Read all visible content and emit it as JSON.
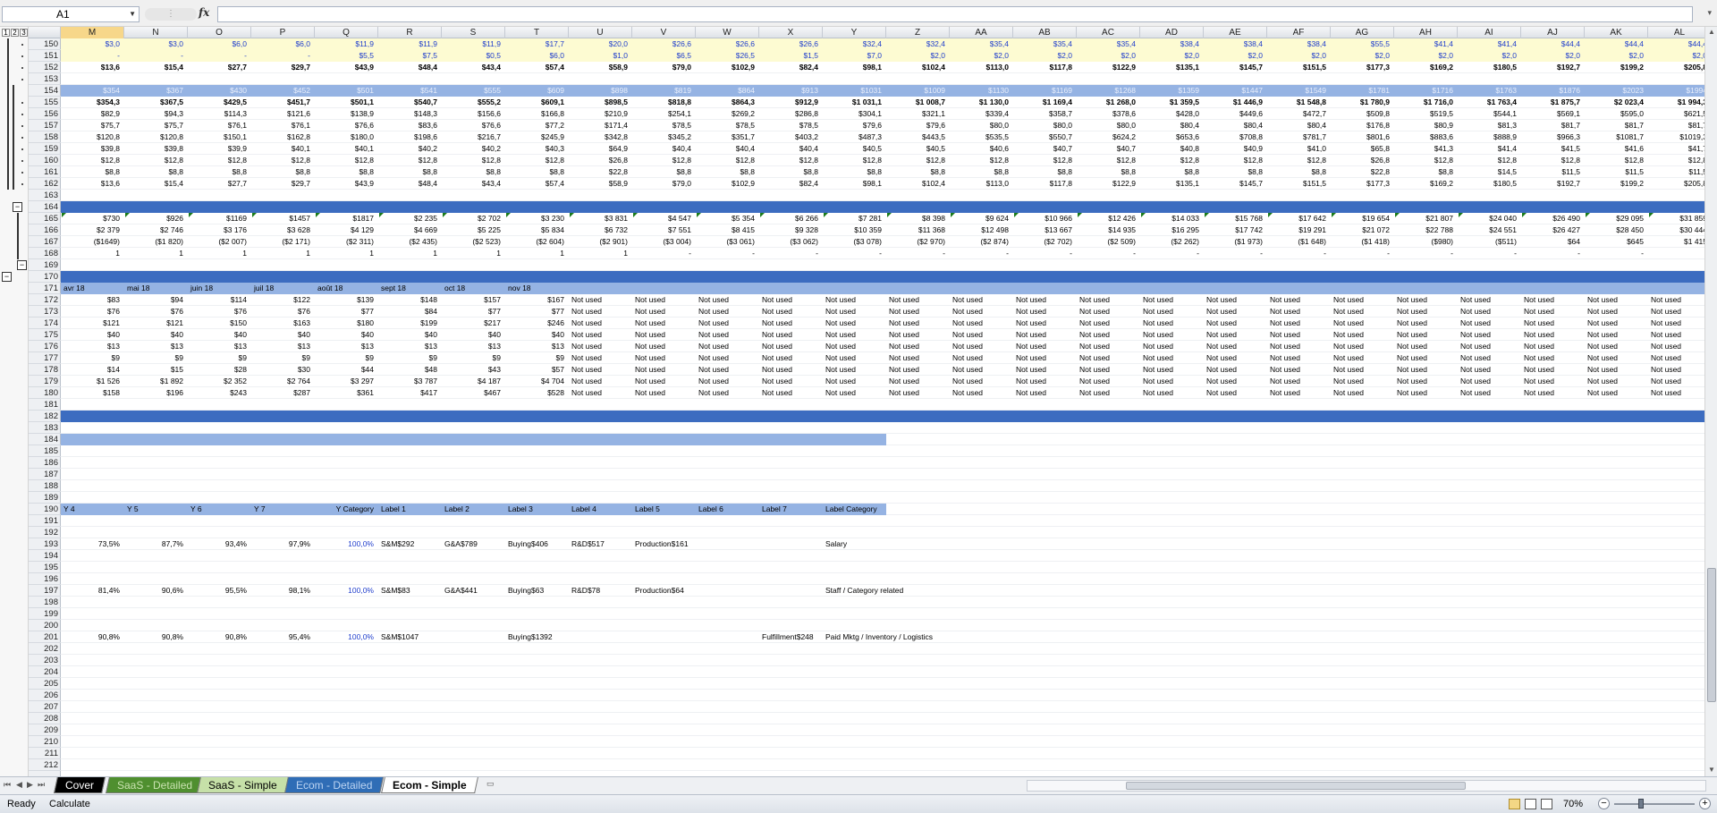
{
  "formula_bar": {
    "name_box": "A1",
    "fx_label": "fx",
    "formula": "",
    "name_box_dropdown": "chevron-down-icon"
  },
  "outline": {
    "levels": [
      "1",
      "2",
      "3"
    ]
  },
  "columns": [
    "M",
    "N",
    "O",
    "P",
    "Q",
    "R",
    "S",
    "T",
    "U",
    "V",
    "W",
    "X",
    "Y",
    "Z",
    "AA",
    "AB",
    "AC",
    "AD",
    "AE",
    "AF",
    "AG",
    "AH",
    "AI",
    "AJ",
    "AK",
    "AL"
  ],
  "rows": {
    "r150": [
      "$3,0",
      "$3,0",
      "$6,0",
      "$6,0",
      "$11,9",
      "$11,9",
      "$11,9",
      "$17,7",
      "$20,0",
      "$26,6",
      "$26,6",
      "$26,6",
      "$32,4",
      "$32,4",
      "$35,4",
      "$35,4",
      "$35,4",
      "$38,4",
      "$38,4",
      "$38,4",
      "$55,5",
      "$41,4",
      "$41,4",
      "$44,4",
      "$44,4",
      "$44,4"
    ],
    "r151": [
      "-",
      "-",
      "-",
      "-",
      "$5,5",
      "$7,5",
      "$0,5",
      "$6,0",
      "$1,0",
      "$6,5",
      "$26,5",
      "$1,5",
      "$7,0",
      "$2,0",
      "$2,0",
      "$2,0",
      "$2,0",
      "$2,0",
      "$2,0",
      "$2,0",
      "$2,0",
      "$2,0",
      "$2,0",
      "$2,0",
      "$2,0",
      "$2,0"
    ],
    "r152": [
      "$13,6",
      "$15,4",
      "$27,7",
      "$29,7",
      "$43,9",
      "$48,4",
      "$43,4",
      "$57,4",
      "$58,9",
      "$79,0",
      "$102,9",
      "$82,4",
      "$98,1",
      "$102,4",
      "$113,0",
      "$117,8",
      "$122,9",
      "$135,1",
      "$145,7",
      "$151,5",
      "$177,3",
      "$169,2",
      "$180,5",
      "$192,7",
      "$199,2",
      "$205,8"
    ],
    "r154": [
      "$354",
      "$367",
      "$430",
      "$452",
      "$501",
      "$541",
      "$555",
      "$609",
      "$898",
      "$819",
      "$864",
      "$913",
      "$1031",
      "$1009",
      "$1130",
      "$1169",
      "$1268",
      "$1359",
      "$1447",
      "$1549",
      "$1781",
      "$1716",
      "$1763",
      "$1876",
      "$2023",
      "$1994"
    ],
    "r155": [
      "$354,3",
      "$367,5",
      "$429,5",
      "$451,7",
      "$501,1",
      "$540,7",
      "$555,2",
      "$609,1",
      "$898,5",
      "$818,8",
      "$864,3",
      "$912,9",
      "$1 031,1",
      "$1 008,7",
      "$1 130,0",
      "$1 169,4",
      "$1 268,0",
      "$1 359,5",
      "$1 446,9",
      "$1 548,8",
      "$1 780,9",
      "$1 716,0",
      "$1 763,4",
      "$1 875,7",
      "$2 023,4",
      "$1 994,3"
    ],
    "r156": [
      "$82,9",
      "$94,3",
      "$114,3",
      "$121,6",
      "$138,9",
      "$148,3",
      "$156,6",
      "$166,8",
      "$210,9",
      "$254,1",
      "$269,2",
      "$286,8",
      "$304,1",
      "$321,1",
      "$339,4",
      "$358,7",
      "$378,6",
      "$428,0",
      "$449,6",
      "$472,7",
      "$509,8",
      "$519,5",
      "$544,1",
      "$569,1",
      "$595,0",
      "$621,5"
    ],
    "r157": [
      "$75,7",
      "$75,7",
      "$76,1",
      "$76,1",
      "$76,6",
      "$83,6",
      "$76,6",
      "$77,2",
      "$171,4",
      "$78,5",
      "$78,5",
      "$78,5",
      "$79,6",
      "$79,6",
      "$80,0",
      "$80,0",
      "$80,0",
      "$80,4",
      "$80,4",
      "$80,4",
      "$176,8",
      "$80,9",
      "$81,3",
      "$81,7",
      "$81,7",
      "$81,7"
    ],
    "r158": [
      "$120,8",
      "$120,8",
      "$150,1",
      "$162,8",
      "$180,0",
      "$198,6",
      "$216,7",
      "$245,9",
      "$342,8",
      "$345,2",
      "$351,7",
      "$403,2",
      "$487,3",
      "$443,5",
      "$535,5",
      "$550,7",
      "$624,2",
      "$653,6",
      "$708,8",
      "$781,7",
      "$801,6",
      "$883,6",
      "$888,9",
      "$966,3",
      "$1081,7",
      "$1019,3"
    ],
    "r159": [
      "$39,8",
      "$39,8",
      "$39,9",
      "$40,1",
      "$40,1",
      "$40,2",
      "$40,2",
      "$40,3",
      "$64,9",
      "$40,4",
      "$40,4",
      "$40,4",
      "$40,5",
      "$40,5",
      "$40,6",
      "$40,7",
      "$40,7",
      "$40,8",
      "$40,9",
      "$41,0",
      "$65,8",
      "$41,3",
      "$41,4",
      "$41,5",
      "$41,6",
      "$41,7"
    ],
    "r160": [
      "$12,8",
      "$12,8",
      "$12,8",
      "$12,8",
      "$12,8",
      "$12,8",
      "$12,8",
      "$12,8",
      "$26,8",
      "$12,8",
      "$12,8",
      "$12,8",
      "$12,8",
      "$12,8",
      "$12,8",
      "$12,8",
      "$12,8",
      "$12,8",
      "$12,8",
      "$12,8",
      "$26,8",
      "$12,8",
      "$12,8",
      "$12,8",
      "$12,8",
      "$12,8"
    ],
    "r161": [
      "$8,8",
      "$8,8",
      "$8,8",
      "$8,8",
      "$8,8",
      "$8,8",
      "$8,8",
      "$8,8",
      "$22,8",
      "$8,8",
      "$8,8",
      "$8,8",
      "$8,8",
      "$8,8",
      "$8,8",
      "$8,8",
      "$8,8",
      "$8,8",
      "$8,8",
      "$8,8",
      "$22,8",
      "$8,8",
      "$14,5",
      "$11,5",
      "$11,5",
      "$11,5"
    ],
    "r162": [
      "$13,6",
      "$15,4",
      "$27,7",
      "$29,7",
      "$43,9",
      "$48,4",
      "$43,4",
      "$57,4",
      "$58,9",
      "$79,0",
      "$102,9",
      "$82,4",
      "$98,1",
      "$102,4",
      "$113,0",
      "$117,8",
      "$122,9",
      "$135,1",
      "$145,7",
      "$151,5",
      "$177,3",
      "$169,2",
      "$180,5",
      "$192,7",
      "$199,2",
      "$205,8"
    ],
    "r165": [
      "$730",
      "$926",
      "$1169",
      "$1457",
      "$1817",
      "$2 235",
      "$2 702",
      "$3 230",
      "$3 831",
      "$4 547",
      "$5 354",
      "$6 266",
      "$7 281",
      "$8 398",
      "$9 624",
      "$10 966",
      "$12 426",
      "$14 033",
      "$15 768",
      "$17 642",
      "$19 654",
      "$21 807",
      "$24 040",
      "$26 490",
      "$29 095",
      "$31 859"
    ],
    "r166": [
      "$2 379",
      "$2 746",
      "$3 176",
      "$3 628",
      "$4 129",
      "$4 669",
      "$5 225",
      "$5 834",
      "$6 732",
      "$7 551",
      "$8 415",
      "$9 328",
      "$10 359",
      "$11 368",
      "$12 498",
      "$13 667",
      "$14 935",
      "$16 295",
      "$17 742",
      "$19 291",
      "$21 072",
      "$22 788",
      "$24 551",
      "$26 427",
      "$28 450",
      "$30 444"
    ],
    "r167": [
      "($1649)",
      "($1 820)",
      "($2 007)",
      "($2 171)",
      "($2 311)",
      "($2 435)",
      "($2 523)",
      "($2 604)",
      "($2 901)",
      "($3 004)",
      "($3 061)",
      "($3 062)",
      "($3 078)",
      "($2 970)",
      "($2 874)",
      "($2 702)",
      "($2 509)",
      "($2 262)",
      "($1 973)",
      "($1 648)",
      "($1 418)",
      "($980)",
      "($511)",
      "$64",
      "$645",
      "$1 415"
    ],
    "r168": [
      "1",
      "1",
      "1",
      "1",
      "1",
      "1",
      "1",
      "1",
      "1",
      "-",
      "-",
      "-",
      "-",
      "-",
      "-",
      "-",
      "-",
      "-",
      "-",
      "-",
      "-",
      "-",
      "-",
      "-",
      "-",
      "-"
    ],
    "r171": [
      "avr 18",
      "mai 18",
      "juin 18",
      "juil 18",
      "août 18",
      "sept 18",
      "oct 18",
      "nov 18"
    ],
    "r172": [
      "$83",
      "$94",
      "$114",
      "$122",
      "$139",
      "$148",
      "$157",
      "$167"
    ],
    "r173": [
      "$76",
      "$76",
      "$76",
      "$76",
      "$77",
      "$84",
      "$77",
      "$77"
    ],
    "r174": [
      "$121",
      "$121",
      "$150",
      "$163",
      "$180",
      "$199",
      "$217",
      "$246"
    ],
    "r175": [
      "$40",
      "$40",
      "$40",
      "$40",
      "$40",
      "$40",
      "$40",
      "$40"
    ],
    "r176": [
      "$13",
      "$13",
      "$13",
      "$13",
      "$13",
      "$13",
      "$13",
      "$13"
    ],
    "r177": [
      "$9",
      "$9",
      "$9",
      "$9",
      "$9",
      "$9",
      "$9",
      "$9"
    ],
    "r178": [
      "$14",
      "$15",
      "$28",
      "$30",
      "$44",
      "$48",
      "$43",
      "$57"
    ],
    "r179": [
      "$1 526",
      "$1 892",
      "$2 352",
      "$2 764",
      "$3 297",
      "$3 787",
      "$4 187",
      "$4 704"
    ],
    "r180": [
      "$158",
      "$196",
      "$243",
      "$287",
      "$361",
      "$417",
      "$467",
      "$528"
    ]
  },
  "not_used_label": "Not used",
  "label_table": {
    "headers": [
      "Y 4",
      "Y 5",
      "Y 6",
      "Y 7",
      "Y Category",
      "Label 1",
      "Label 2",
      "Label 3",
      "Label 4",
      "Label 5",
      "Label 6",
      "Label 7",
      "Label Category"
    ],
    "r193": [
      "73,5%",
      "87,7%",
      "93,4%",
      "97,9%",
      "100,0%",
      "S&M$292",
      "G&A$789",
      "Buying$406",
      "R&D$517",
      "Production$161",
      "",
      "",
      "Salary"
    ],
    "r197": [
      "81,4%",
      "90,6%",
      "95,5%",
      "98,1%",
      "100,0%",
      "S&M$83",
      "G&A$441",
      "Buying$63",
      "R&D$78",
      "Production$64",
      "",
      "",
      "Staff / Category related"
    ],
    "r201": [
      "90,8%",
      "90,8%",
      "90,8%",
      "95,4%",
      "100,0%",
      "S&M$1047",
      "",
      "Buying$1392",
      "",
      "",
      "",
      "Fulfillment$248",
      "Paid Mktg / Inventory / Logistics"
    ]
  },
  "row_numbers": [
    "150",
    "151",
    "152",
    "153",
    "154",
    "155",
    "156",
    "157",
    "158",
    "159",
    "160",
    "161",
    "162",
    "163",
    "164",
    "165",
    "166",
    "167",
    "168",
    "169",
    "170",
    "171",
    "172",
    "173",
    "174",
    "175",
    "176",
    "177",
    "178",
    "179",
    "180",
    "181",
    "182",
    "183",
    "184",
    "185",
    "186",
    "187",
    "188",
    "189",
    "190",
    "191",
    "192",
    "193",
    "194",
    "195",
    "196",
    "197",
    "198",
    "199",
    "200",
    "201",
    "202",
    "203",
    "204",
    "205",
    "206",
    "207",
    "208",
    "209",
    "210",
    "211",
    "212"
  ],
  "sheet_tabs": [
    {
      "label": "Cover",
      "color": "#000000",
      "text": "#ffffff"
    },
    {
      "label": "SaaS - Detailed",
      "color": "#4f8f2f",
      "text": "#c9e2b0"
    },
    {
      "label": "SaaS - Simple",
      "color": "#c6e0a8",
      "text": "#000000"
    },
    {
      "label": "Ecom - Detailed",
      "color": "#2f6db6",
      "text": "#bcd4f2"
    },
    {
      "label": "Ecom - Simple",
      "color": "#ffffff",
      "text": "#000000"
    }
  ],
  "status": {
    "ready": "Ready",
    "calculate": "Calculate",
    "zoom": "70%"
  },
  "colors": {
    "header_dark": "#3c6cc0",
    "header_light": "#95b3e3",
    "input_yellow": "#fdfbd2",
    "input_blue_text": "#1f3dcc"
  }
}
